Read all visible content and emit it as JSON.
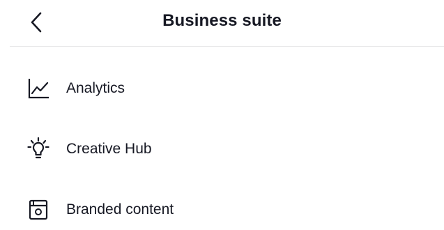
{
  "header": {
    "title": "Business suite",
    "back_icon": "chevron-left-icon"
  },
  "menu": {
    "items": [
      {
        "label": "Analytics",
        "icon": "analytics-chart-icon"
      },
      {
        "label": "Creative Hub",
        "icon": "lightbulb-icon"
      },
      {
        "label": "Branded content",
        "icon": "branded-content-icon"
      }
    ]
  },
  "colors": {
    "text": "#161823",
    "divider": "#e6e6e8",
    "background": "#ffffff"
  }
}
